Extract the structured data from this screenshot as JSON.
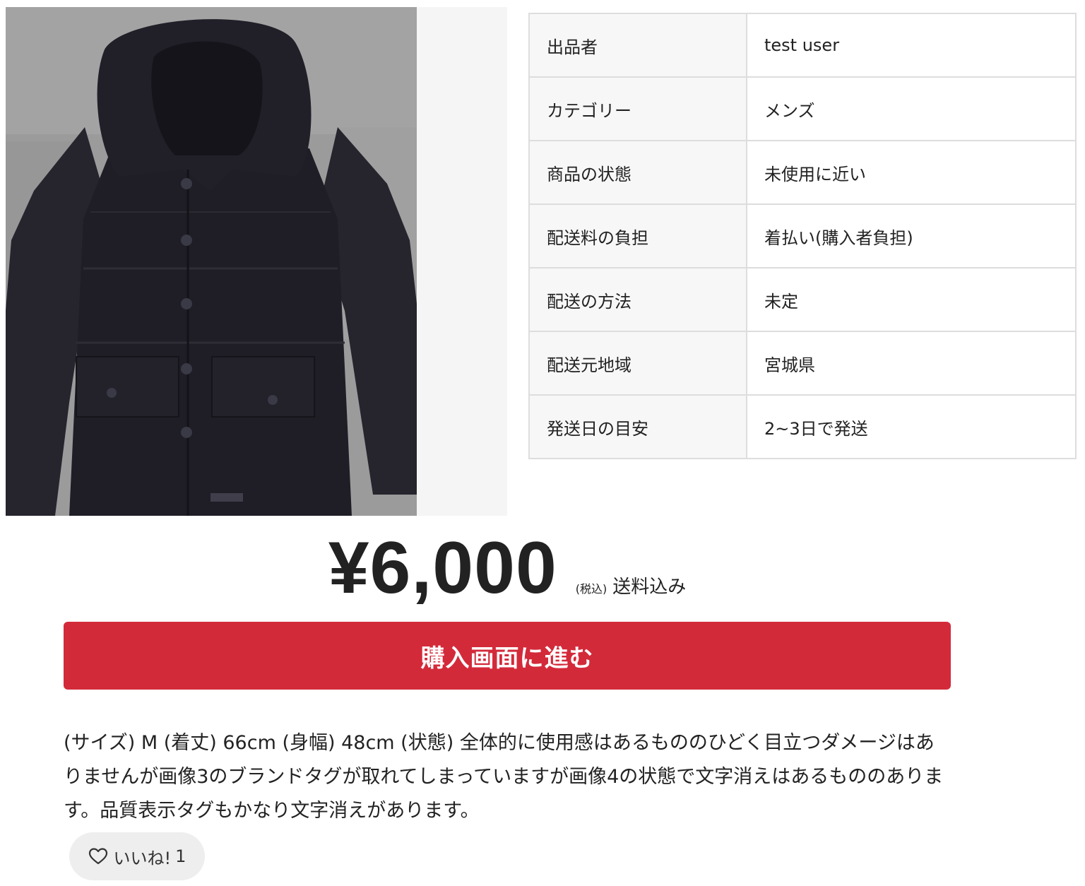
{
  "product": {
    "image": {
      "subject": "black-hooded-down-jacket-photo",
      "background_color": "#9b9b9b",
      "jacket_color": "#1f1e26"
    },
    "details": [
      {
        "label": "出品者",
        "value": "test user"
      },
      {
        "label": "カテゴリー",
        "value": "メンズ"
      },
      {
        "label": "商品の状態",
        "value": "未使用に近い"
      },
      {
        "label": "配送料の負担",
        "value": "着払い(購入者負担)"
      },
      {
        "label": "配送の方法",
        "value": "未定"
      },
      {
        "label": "配送元地域",
        "value": "宮城県"
      },
      {
        "label": "発送日の目安",
        "value": "2~3日で発送"
      }
    ],
    "price": "¥6,000",
    "tax_note": "(税込)",
    "shipping_note": "送料込み",
    "buy_button_label": "購入画面に進む",
    "description": "(サイズ) M (着丈) 66cm (身幅) 48cm (状態) 全体的に使用感はあるもののひどく目立つダメージはありませんが画像3のブランドタグが取れてしまっていますが画像4の状態で文字消えはあるもののあります。品質表示タグもかなり文字消えがあります。",
    "like": {
      "icon": "heart-outline-icon",
      "label": "いいね!",
      "count": "1"
    }
  },
  "colors": {
    "buy_button": "#d32a3a",
    "table_border": "#dddddd",
    "table_key_bg": "#f7f7f7",
    "like_button_bg": "#eeeeee"
  }
}
